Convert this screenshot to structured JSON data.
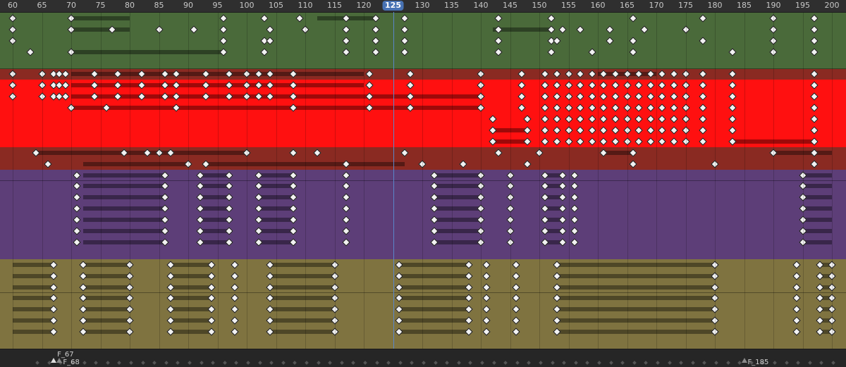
{
  "ruler": {
    "labels": [
      "60",
      "65",
      "70",
      "75",
      "80",
      "85",
      "90",
      "95",
      "100",
      "105",
      "110",
      "115",
      "120",
      "125",
      "130",
      "135",
      "140",
      "145",
      "150",
      "155",
      "160",
      "165",
      "170",
      "175",
      "180",
      "185",
      "190",
      "195",
      "200"
    ],
    "current_frame": "125"
  },
  "colors": {
    "green": "#4a6a3a",
    "red_dark": "#8a2a22",
    "red_bright": "#ff1010",
    "purple": "#5d3e78",
    "olive": "#7f7340",
    "playhead": "#4772b3"
  },
  "tracks": {
    "groups": [
      {
        "name": "green-group",
        "color": "green",
        "rows": 5
      },
      {
        "name": "red-group",
        "color": "red",
        "rows": 9
      },
      {
        "name": "purple-group",
        "color": "purple",
        "rows": 8
      },
      {
        "name": "olive-group",
        "color": "olive",
        "rows": 8
      }
    ]
  },
  "markers": [
    {
      "label": "F_67",
      "frame": 67
    },
    {
      "label": "F_68",
      "frame": 68
    },
    {
      "label": "F_185",
      "frame": 185
    }
  ]
}
